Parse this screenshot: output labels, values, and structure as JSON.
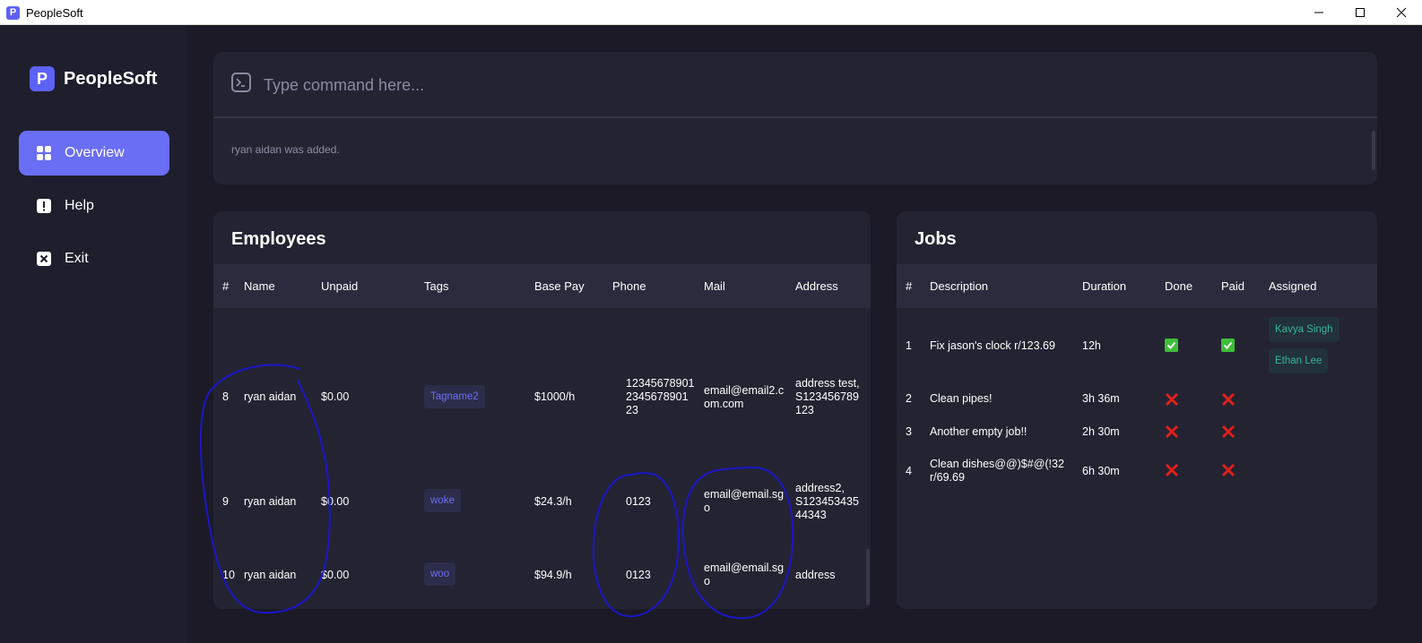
{
  "window": {
    "title": "PeopleSoft"
  },
  "sidebar": {
    "brand": "PeopleSoft",
    "items": [
      {
        "label": "Overview",
        "icon": "grid-icon",
        "active": true
      },
      {
        "label": "Help",
        "icon": "exclamation-icon",
        "active": false
      },
      {
        "label": "Exit",
        "icon": "close-box-icon",
        "active": false
      }
    ]
  },
  "command": {
    "placeholder": "Type command here...",
    "result": "ryan aidan was added."
  },
  "employees": {
    "title": "Employees",
    "columns": [
      "#",
      "Name",
      "Unpaid",
      "Tags",
      "Base Pay",
      "Phone",
      "Mail",
      "Address"
    ],
    "rows": [
      {
        "index": "8",
        "name": "ryan aidan",
        "unpaid": "$0.00",
        "tag": "Tagname2",
        "base_pay": "$1000/h",
        "phone": [
          "12345678901",
          "2345678901",
          "23"
        ],
        "mail": [
          "email@email2.c",
          "om.com"
        ],
        "address": [
          "address test,",
          "S123456789",
          "123"
        ]
      },
      {
        "index": "9",
        "name": "ryan aidan",
        "unpaid": "$0.00",
        "tag": "woke",
        "base_pay": "$24.3/h",
        "phone": [
          "0123"
        ],
        "mail": [
          "email@email.sg",
          "o"
        ],
        "address": [
          "address2,",
          "S123453435",
          "44343"
        ]
      },
      {
        "index": "10",
        "name": "ryan aidan",
        "unpaid": "$0.00",
        "tag": "woo",
        "base_pay": "$94.9/h",
        "phone": [
          "0123"
        ],
        "mail": [
          "email@email.sg",
          "o"
        ],
        "address": [
          "address"
        ]
      }
    ]
  },
  "jobs": {
    "title": "Jobs",
    "columns": [
      "#",
      "Description",
      "Duration",
      "Done",
      "Paid",
      "Assigned"
    ],
    "rows": [
      {
        "index": "1",
        "description": [
          "Fix jason's clock r/123.69"
        ],
        "duration": "12h",
        "done": true,
        "paid": true,
        "assigned": [
          "Kavya Singh",
          "Ethan Lee"
        ]
      },
      {
        "index": "2",
        "description": [
          "Clean pipes!"
        ],
        "duration": "3h 36m",
        "done": false,
        "paid": false,
        "assigned": []
      },
      {
        "index": "3",
        "description": [
          "Another empty job!!"
        ],
        "duration": "2h 30m",
        "done": false,
        "paid": false,
        "assigned": []
      },
      {
        "index": "4",
        "description": [
          "Clean dishes@@)$#@(!32",
          "r/69.69"
        ],
        "duration": "6h 30m",
        "done": false,
        "paid": false,
        "assigned": []
      }
    ]
  },
  "colors": {
    "accent": "#6a6ef5",
    "background": "#1b1a26",
    "panel": "#242332",
    "done_check": "#3fbe3a",
    "not_done_cross": "#e0201b",
    "assignee_text": "#34b49a",
    "annotation_ink": "#1a16c8"
  }
}
